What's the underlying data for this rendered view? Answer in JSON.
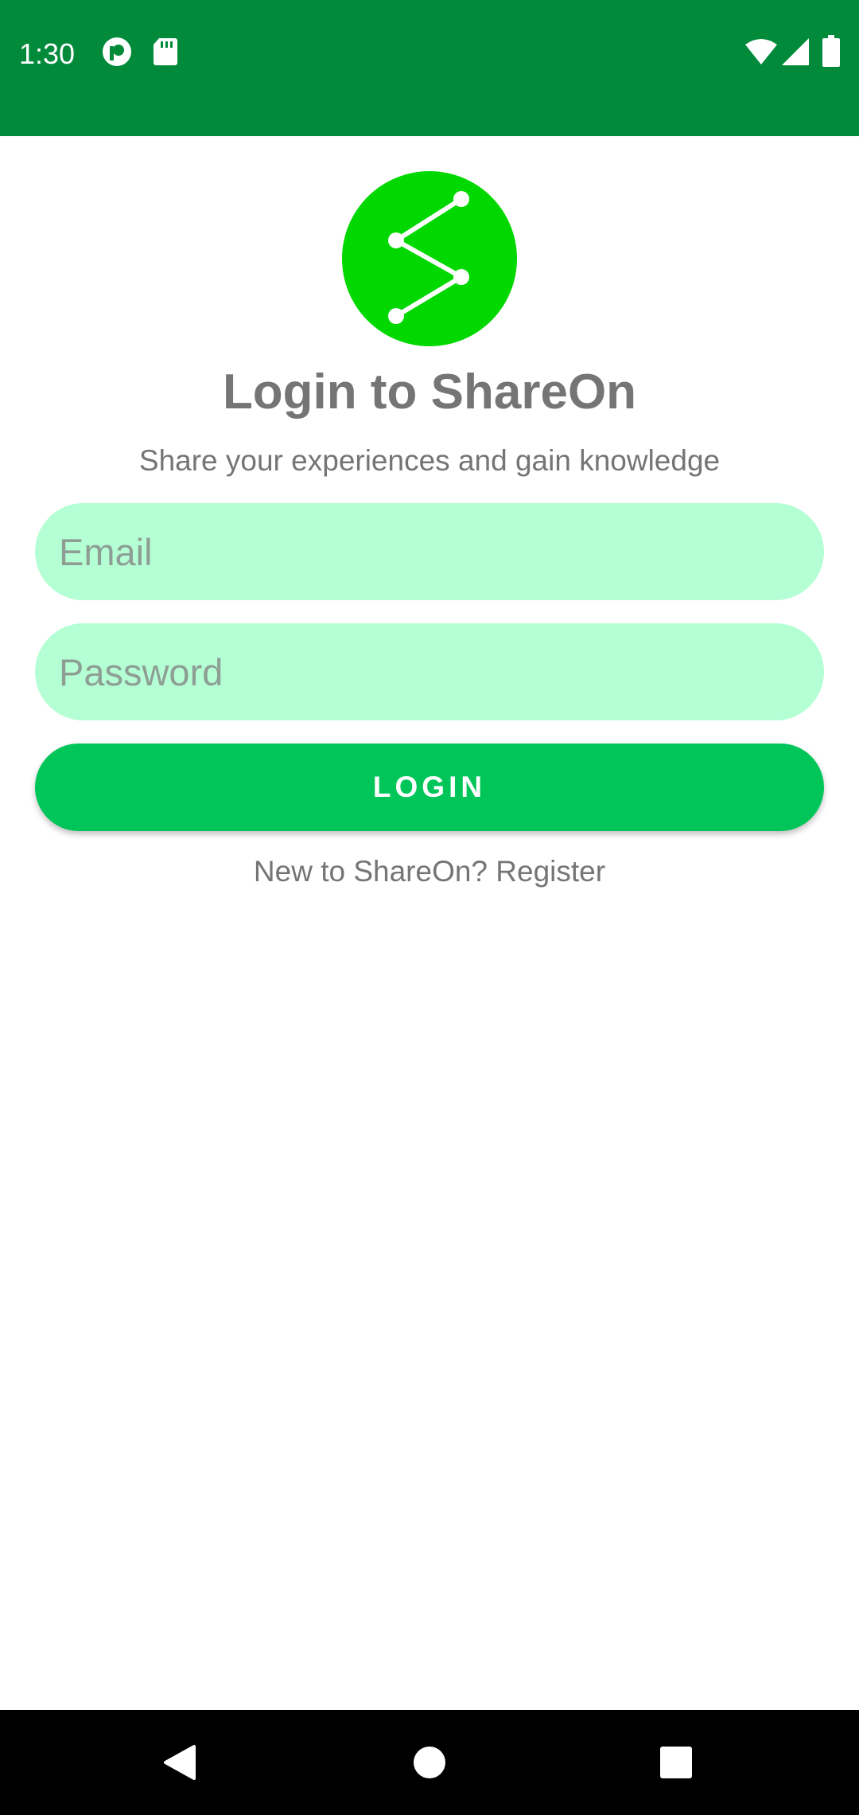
{
  "status_bar": {
    "time": "1:30",
    "icons": [
      "pocket-casts-icon",
      "sd-card-icon",
      "wifi-icon",
      "signal-icon",
      "battery-icon"
    ],
    "bg_color": "#008A3A"
  },
  "logo": {
    "icon": "share-icon",
    "color": "#00D800"
  },
  "title": "Login to ShareOn",
  "subtitle": "Share your experiences and gain knowledge",
  "email": {
    "placeholder": "Email",
    "value": ""
  },
  "password": {
    "placeholder": "Password",
    "value": ""
  },
  "login_button": {
    "label": "LOGIN",
    "color": "#00C65A"
  },
  "register_link": "New to ShareOn? Register",
  "nav_bar": {
    "buttons": [
      "back-icon",
      "home-icon",
      "recents-icon"
    ]
  }
}
